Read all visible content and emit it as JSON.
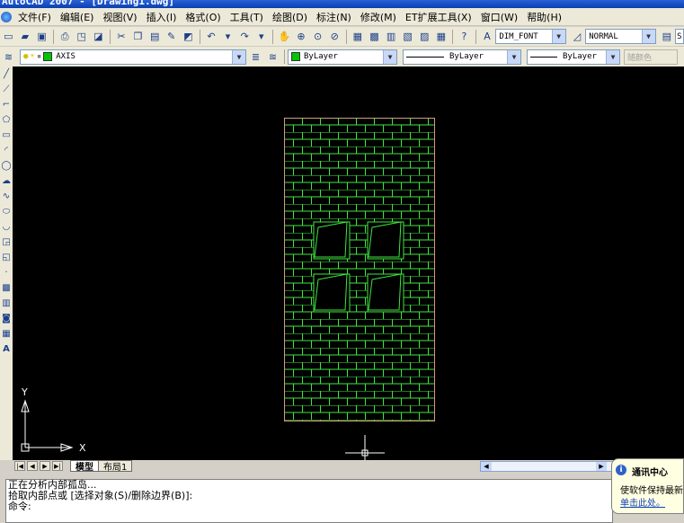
{
  "window": {
    "title": "AutoCAD 2007 - [Drawing1.dwg]"
  },
  "menu": [
    "文件(F)",
    "编辑(E)",
    "视图(V)",
    "插入(I)",
    "格式(O)",
    "工具(T)",
    "绘图(D)",
    "标注(N)",
    "修改(M)",
    "ET扩展工具(X)",
    "窗口(W)",
    "帮助(H)"
  ],
  "toolbar": {
    "text_style": "DIM_FONT",
    "dim_style": "NORMAL",
    "standard_truncated": "S"
  },
  "layers": {
    "current_layer": "AXIS",
    "color": "ByLayer",
    "linetype": "ByLayer",
    "lineweight": "ByLayer",
    "plot_style": "随颜色"
  },
  "ucs": {
    "x_label": "X",
    "y_label": "Y"
  },
  "tabs": {
    "model": "模型",
    "layout1": "布局1"
  },
  "command": {
    "lines": [
      "正在分析内部孤岛...",
      "拾取内部点或 [选择对象(S)/删除边界(B)]:",
      "命令:"
    ]
  },
  "balloon": {
    "title": "通讯中心",
    "message": "使软件保持最新",
    "link": "单击此处。"
  },
  "colors": {
    "canvas": "#000000",
    "brick": "#3fe63f",
    "title_bar": "#0a3fb0",
    "bylayer_swatch": "#00c800"
  }
}
